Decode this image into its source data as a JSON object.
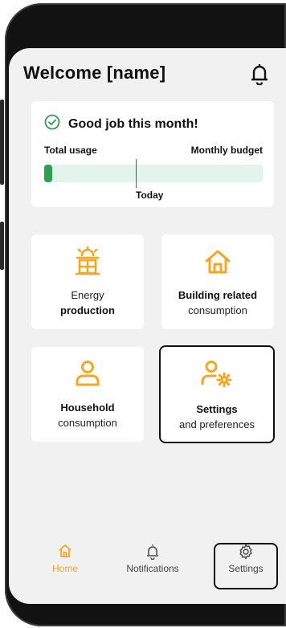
{
  "header": {
    "title": "Welcome [name]"
  },
  "budget_card": {
    "title": "Good job this month!",
    "left_label": "Total usage",
    "right_label": "Monthly budget",
    "today_label": "Today",
    "usage_fraction": 0.035,
    "today_fraction": 0.48,
    "colors": {
      "fill": "#2e9e52",
      "track": "#e3f4ec",
      "check": "#2e9e52"
    }
  },
  "tiles": [
    {
      "line1": "Energy",
      "line2": "production",
      "icon": "solar-panel-icon"
    },
    {
      "line1": "Building related",
      "line2": "consumption",
      "icon": "home-icon"
    },
    {
      "line1": "Household",
      "line2": "consumption",
      "icon": "user-icon"
    },
    {
      "line1": "Settings",
      "line2": "and preferences",
      "icon": "user-settings-icon"
    }
  ],
  "nav": {
    "home": "Home",
    "notifications": "Notifications",
    "settings": "Settings"
  },
  "colors": {
    "accent": "#f5a623",
    "background": "#f1f1f1"
  }
}
